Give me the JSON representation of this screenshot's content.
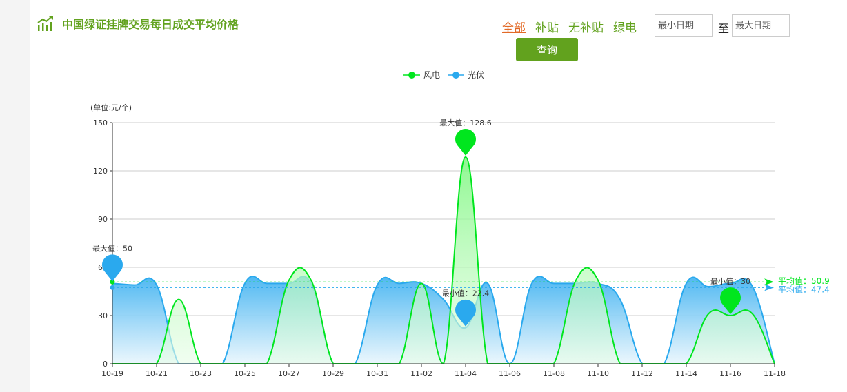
{
  "header": {
    "title": "中国绿证挂牌交易每日成交平均价格",
    "icon": "trend-chart-icon"
  },
  "filters": [
    "全部",
    "补贴",
    "无补贴",
    "绿电"
  ],
  "active_filter": "全部",
  "date_range": {
    "min_placeholder": "最小日期",
    "to_label": "至",
    "max_placeholder": "最大日期"
  },
  "query_button": "查询",
  "colors": {
    "brand": "#62a21e",
    "active_filter": "#e26a27",
    "wind": "#00e61e",
    "solar": "#2aa9ee"
  },
  "chart_data": {
    "type": "area",
    "unit_label": "(单位:元/个)",
    "x": [
      "10-19",
      "10-20",
      "10-21",
      "10-22",
      "10-23",
      "10-24",
      "10-25",
      "10-26",
      "10-27",
      "10-28",
      "10-29",
      "10-30",
      "10-31",
      "11-01",
      "11-02",
      "11-03",
      "11-04",
      "11-05",
      "11-06",
      "11-07",
      "11-08",
      "11-09",
      "11-10",
      "11-11",
      "11-12",
      "11-13",
      "11-14",
      "11-15",
      "11-16",
      "11-17",
      "11-18"
    ],
    "x_tick_labels": [
      "10-19",
      "10-21",
      "10-23",
      "10-25",
      "10-27",
      "10-29",
      "10-31",
      "11-02",
      "11-04",
      "11-06",
      "11-08",
      "11-10",
      "11-12",
      "11-14",
      "11-16",
      "11-18"
    ],
    "ylim": [
      0,
      150
    ],
    "y_ticks": [
      0,
      30,
      60,
      90,
      120,
      150
    ],
    "grid": true,
    "legend_position": "top-center",
    "series": [
      {
        "name": "风电",
        "color": "#00e61e",
        "values": [
          0,
          0,
          0,
          40,
          0,
          0,
          0,
          0,
          52,
          52,
          0,
          0,
          0,
          0,
          50,
          0,
          128.6,
          0,
          0,
          0,
          0,
          52,
          52,
          0,
          0,
          0,
          0,
          31,
          30,
          31,
          0
        ],
        "max_label": "最大值：128.6",
        "min_label": "最小值：30",
        "avg_label": "平均值：50.9",
        "avg": 50.9
      },
      {
        "name": "光伏",
        "color": "#2aa9ee",
        "values": [
          50,
          49,
          49,
          0,
          0,
          0,
          50,
          50,
          50,
          50,
          0,
          0,
          49,
          50,
          50,
          40,
          22.4,
          50,
          0,
          50,
          50,
          50,
          50,
          40,
          0,
          0,
          50,
          48,
          50,
          48,
          0
        ],
        "max_label": "最大值：50",
        "min_label": "最小值：22.4",
        "avg_label": "平均值：47.4",
        "avg": 47.4
      }
    ]
  }
}
